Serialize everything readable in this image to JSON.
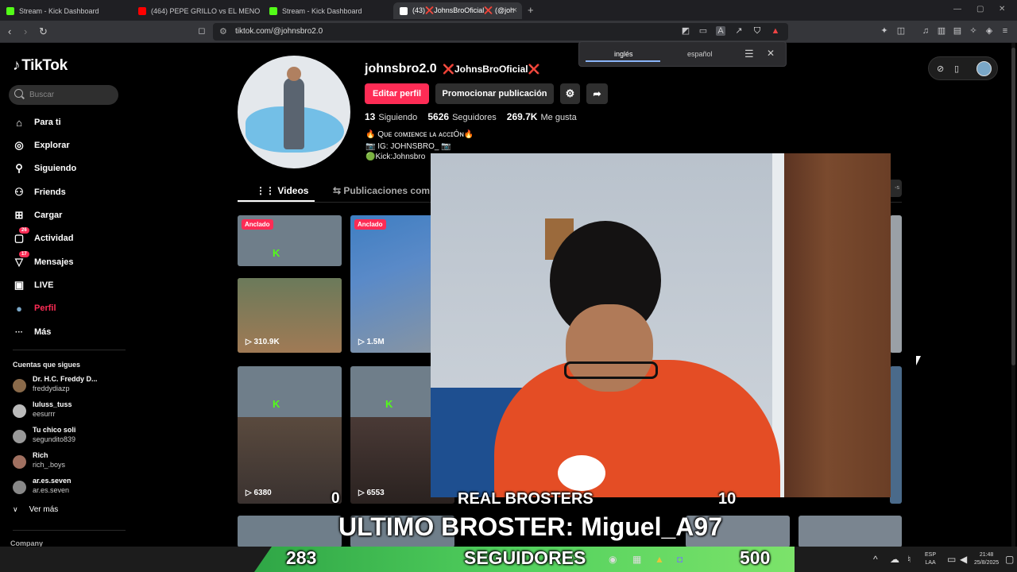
{
  "browser": {
    "tabs": [
      {
        "title": "Stream - Kick Dashboard",
        "favicon_color": "#53fc18",
        "active": false
      },
      {
        "title": "(464) PEPE GRILLO vs EL MENOR I #F",
        "favicon_color": "#ff0000",
        "active": false
      },
      {
        "title": "Stream - Kick Dashboard",
        "favicon_color": "#53fc18",
        "active": false
      },
      {
        "title": "(43)❌JohnsBroOficial❌ (@joh",
        "favicon_color": "#ffffff",
        "active": true
      }
    ],
    "new_tab": "+",
    "url": "tiktok.com/@johnsbro2.0"
  },
  "translate_popup": {
    "source_lang": "inglés",
    "target_lang": "español"
  },
  "tiktok": {
    "logo": "TikTok",
    "search_placeholder": "Buscar",
    "nav": [
      {
        "label": "Para ti",
        "icon": "home-icon",
        "glyph": "⌂"
      },
      {
        "label": "Explorar",
        "icon": "compass-icon",
        "glyph": "◎"
      },
      {
        "label": "Siguiendo",
        "icon": "following-icon",
        "glyph": "⚲"
      },
      {
        "label": "Friends",
        "icon": "friends-icon",
        "glyph": "⚇"
      },
      {
        "label": "Cargar",
        "icon": "upload-icon",
        "glyph": "⊞"
      },
      {
        "label": "Actividad",
        "icon": "activity-icon",
        "glyph": "▢",
        "badge": "26"
      },
      {
        "label": "Mensajes",
        "icon": "messages-icon",
        "glyph": "▽",
        "badge": "17"
      },
      {
        "label": "LIVE",
        "icon": "live-icon",
        "glyph": "▣"
      },
      {
        "label": "Perfil",
        "icon": "profile-avatar-icon",
        "glyph": "●",
        "active": true
      },
      {
        "label": "Más",
        "icon": "more-icon",
        "glyph": "···"
      }
    ],
    "following_heading": "Cuentas que sigues",
    "accounts": [
      {
        "name": "Dr. H.C. Freddy D...",
        "handle": "freddydiazp"
      },
      {
        "name": "luluss_tuss",
        "handle": "eesurrr"
      },
      {
        "name": "Tu chico soli",
        "handle": "segundito839"
      },
      {
        "name": "Rich",
        "handle": "rich_.boys"
      },
      {
        "name": "ar.es.seven",
        "handle": "ar.es.seven"
      }
    ],
    "see_more": "Ver más",
    "company": "Company",
    "accent_color": "#fe2c55"
  },
  "profile": {
    "username": "johnsbro2.0",
    "nickname_prefix": "❌",
    "nickname_core": "JohnsBroOficial",
    "nickname_suffix": "❌",
    "edit_button": "Editar perfil",
    "promote_button": "Promocionar publicación",
    "stats": {
      "following_count": "13",
      "following_label": "Siguiendo",
      "followers_count": "5626",
      "followers_label": "Seguidores",
      "likes_count": "269.7K",
      "likes_label": "Me gusta"
    },
    "bio": [
      "🔥 Qᴜᴇ ᴄᴏᴍɪᴇɴᴄᴇ ʟᴀ ᴀᴄᴄɪÓɴ🔥",
      "📷 IG: JOHNSBRO_ 📷",
      "🟢Kick:Johnsbro"
    ],
    "tabs": {
      "videos": "Videos",
      "reposts": "Publicaciones comp"
    }
  },
  "videos": [
    {
      "pinned_label": "Anclado",
      "views": "",
      "colorA": "#6f7e8a",
      "colorB": "#9aa5ad"
    },
    {
      "pinned_label": "Anclado",
      "views": "1.5M",
      "colorA": "#3f7ec2",
      "colorB": "#8a95a0"
    },
    {
      "pinned_label": "",
      "views": "310.9K",
      "colorA": "#6b7a5a",
      "colorB": "#8e7a5e"
    },
    {
      "pinned_label": "",
      "views": "6380",
      "colorA": "#6f7e8a",
      "colorB": "#5a4a3e"
    },
    {
      "pinned_label": "",
      "views": "6553",
      "colorA": "#6f7e8a",
      "colorB": "#4a3a36"
    }
  ],
  "stream_overlay": {
    "real_brosters_label": "REAL BROSTERS",
    "real_brosters_left": "0",
    "real_brosters_right": "10",
    "last_broster": "ULTIMO BROSTER: Miguel_A97",
    "followers_current": "283",
    "followers_label": "SEGUIDORES",
    "followers_goal": "500"
  },
  "taskbar": {
    "lang_top": "ESP",
    "lang_bottom": "LAA",
    "time": "21:48",
    "date": "25/8/2025"
  }
}
